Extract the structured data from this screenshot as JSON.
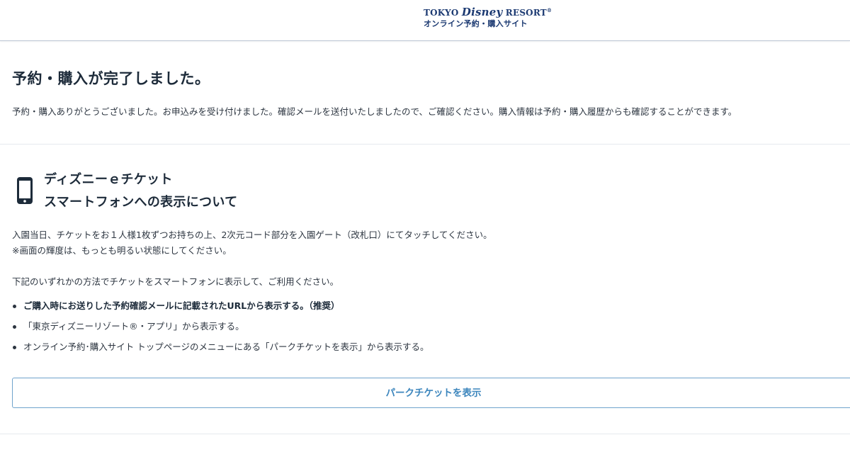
{
  "header": {
    "logo_top_prefix": "TOKYO ",
    "logo_disney": "Disney",
    "logo_top_suffix": " RESORT",
    "logo_registered": "®",
    "logo_sub": "オンライン予約・購入サイト"
  },
  "completion": {
    "title": "予約・購入が完了しました。",
    "message": "予約・購入ありがとうございました。お申込みを受け付けました。確認メールを送付いたしましたので、ご確認ください。購入情報は予約・購入履歴からも確認することができます。"
  },
  "eticket": {
    "icon": "smartphone-icon",
    "title_line1": "ディズニーｅチケット",
    "title_line2": "スマートフォンへの表示について",
    "instruction_line1": "入園当日、チケットをお１人様1枚ずつお持ちの上、2次元コード部分を入園ゲート（改札口）にてタッチしてください。",
    "instruction_line2": "※画面の輝度は、もっとも明るい状態にしてください。",
    "methods_intro": "下記のいずれかの方法でチケットをスマートフォンに表示して、ご利用ください。",
    "methods": [
      "ご購入時にお送りした予約確認メールに記載されたURLから表示する。（推奨）",
      "「東京ディズニーリゾート®・アプリ」から表示する。",
      "オンライン予約･購入サイト トップページのメニューにある「パークチケットを表示」から表示する。"
    ],
    "show_ticket_button": "パークチケットを表示"
  },
  "colors": {
    "brand_navy": "#1c3a72",
    "button_border": "#6fa3cc",
    "button_text": "#3d86bd",
    "heading_text": "#1d2b3a"
  }
}
